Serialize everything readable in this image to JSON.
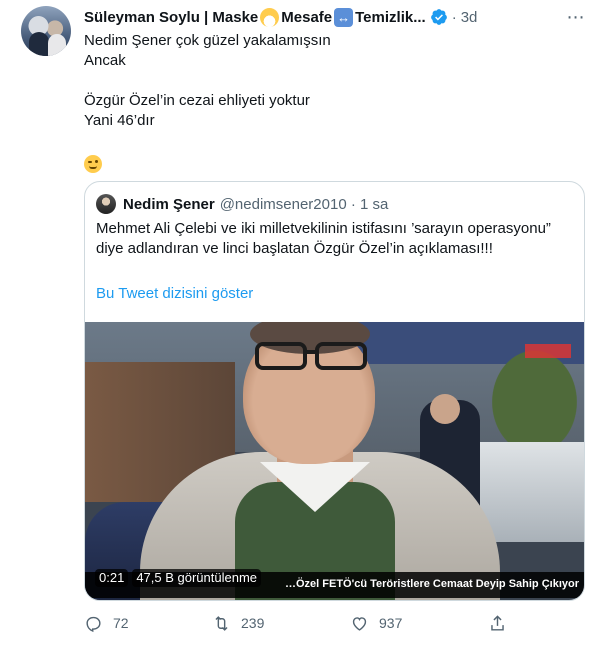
{
  "tweet": {
    "author_name": "Süleyman Soylu | Maske",
    "name_part2": "Mesafe",
    "name_part3": "Temizlik...",
    "time": "3d",
    "dot": "·",
    "more_glyph": "⋯",
    "lines": [
      "Nedim Şener çok güzel yakalamışsın",
      "Ancak",
      "",
      "Özgür Özel’in cezai ehliyeti yoktur",
      "Yani 46’dır"
    ]
  },
  "quoted": {
    "author_name": "Nedim Şener",
    "handle": "@nedimsener2010",
    "dot": " · ",
    "time": "1 sa",
    "text": "Mehmet Ali Çelebi ve iki milletvekilinin istifasını ’sarayın operasyonu” diye adlandıran ve linci başlatan Özgür Özel’in açıklaması!!!",
    "thread_link": "Bu Tweet dizisini göster",
    "video": {
      "duration": "0:21",
      "views": "47,5 B görüntülenme",
      "ticker": "…Özel FETÖ'cü Teröristlere Cemaat Deyip Sahip Çıkıyor"
    }
  },
  "actions": {
    "replies": "72",
    "retweets": "239",
    "likes": "937"
  },
  "colors": {
    "text": "#0f1419",
    "secondary": "#536471",
    "link": "#1d9bf0",
    "border": "#cfd9de",
    "verified": "#1d9bf0"
  },
  "icons": [
    "mask-emoji-icon",
    "left-right-arrow-emoji-icon",
    "verified-badge-icon",
    "more-icon",
    "winking-face-emoji-icon",
    "reply-icon",
    "retweet-icon",
    "like-icon",
    "share-icon"
  ]
}
